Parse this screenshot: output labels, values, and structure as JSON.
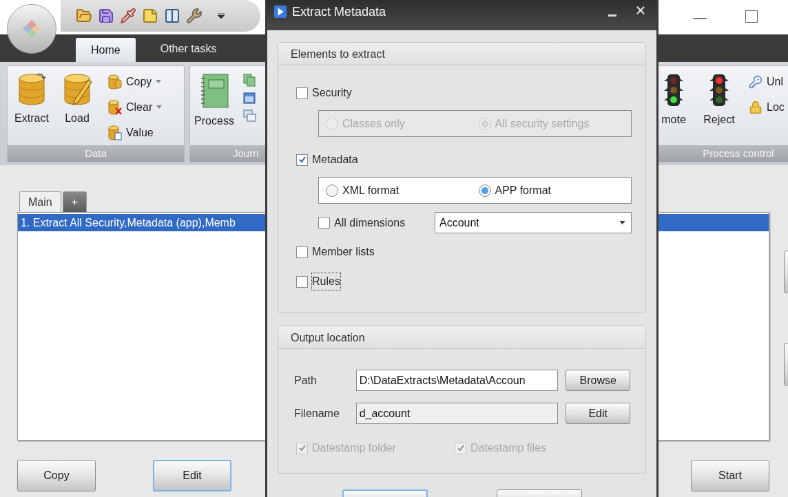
{
  "ribbon": {
    "tabs": [
      {
        "label": "Home",
        "selected": true
      },
      {
        "label": "Other tasks",
        "selected": false
      }
    ],
    "groups": [
      {
        "label": "Data",
        "items": [
          {
            "label": "Extract",
            "kind": "large"
          },
          {
            "label": "Load",
            "kind": "large"
          },
          {
            "label": "Copy",
            "kind": "small",
            "dropdown": true
          },
          {
            "label": "Clear",
            "kind": "small",
            "dropdown": true
          },
          {
            "label": "Value",
            "kind": "small",
            "dropdown": false
          }
        ]
      },
      {
        "label": "Journ",
        "items": [
          {
            "label": "Process",
            "kind": "large"
          }
        ]
      },
      {
        "label": "Process control",
        "items": [
          {
            "label": "mote",
            "kind": "large"
          },
          {
            "label": "Reject",
            "kind": "large"
          },
          {
            "label": "Unl",
            "kind": "small"
          },
          {
            "label": "Loc",
            "kind": "small"
          }
        ]
      }
    ]
  },
  "list_tabs": [
    {
      "label": "Main",
      "selected": true
    },
    {
      "label": "+",
      "selected": false
    }
  ],
  "list": [
    {
      "text": "1. Extract All Security,Metadata (app),Memb",
      "selected": true
    }
  ],
  "buttons": [
    {
      "label": "Copy",
      "focused": false
    },
    {
      "label": "Edit",
      "focused": true
    },
    {
      "label": "Start",
      "focused": false
    }
  ],
  "dialog": {
    "title": "Extract Metadata",
    "elements": {
      "title": "Elements to extract",
      "security": {
        "label": "Security",
        "checked": false
      },
      "security_scope": {
        "disabled": true,
        "options": [
          {
            "label": "Classes only",
            "selected": false
          },
          {
            "label": "All security settings",
            "selected": true
          }
        ]
      },
      "metadata": {
        "label": "Metadata",
        "checked": true
      },
      "metadata_format": {
        "disabled": false,
        "options": [
          {
            "label": "XML format",
            "selected": false
          },
          {
            "label": "APP format",
            "selected": true
          }
        ]
      },
      "all_dimensions": {
        "label": "All dimensions",
        "checked": false
      },
      "dimension": {
        "value": "Account"
      },
      "member_lists": {
        "label": "Member lists",
        "checked": false,
        "focused": false
      },
      "rules": {
        "label": "Rules",
        "checked": false,
        "focused": true
      }
    },
    "output": {
      "title": "Output location",
      "path": {
        "label": "Path",
        "value": "D:\\DataExtracts\\Metadata\\Accoun",
        "readonly": false,
        "button": "Browse"
      },
      "filename": {
        "label": "Filename",
        "value": "d_account",
        "readonly": true,
        "button": "Edit"
      },
      "datestamp": [
        {
          "label": "Datestamp folder",
          "checked": true,
          "disabled": true
        },
        {
          "label": "Datestamp files",
          "checked": true,
          "disabled": true
        }
      ]
    }
  }
}
